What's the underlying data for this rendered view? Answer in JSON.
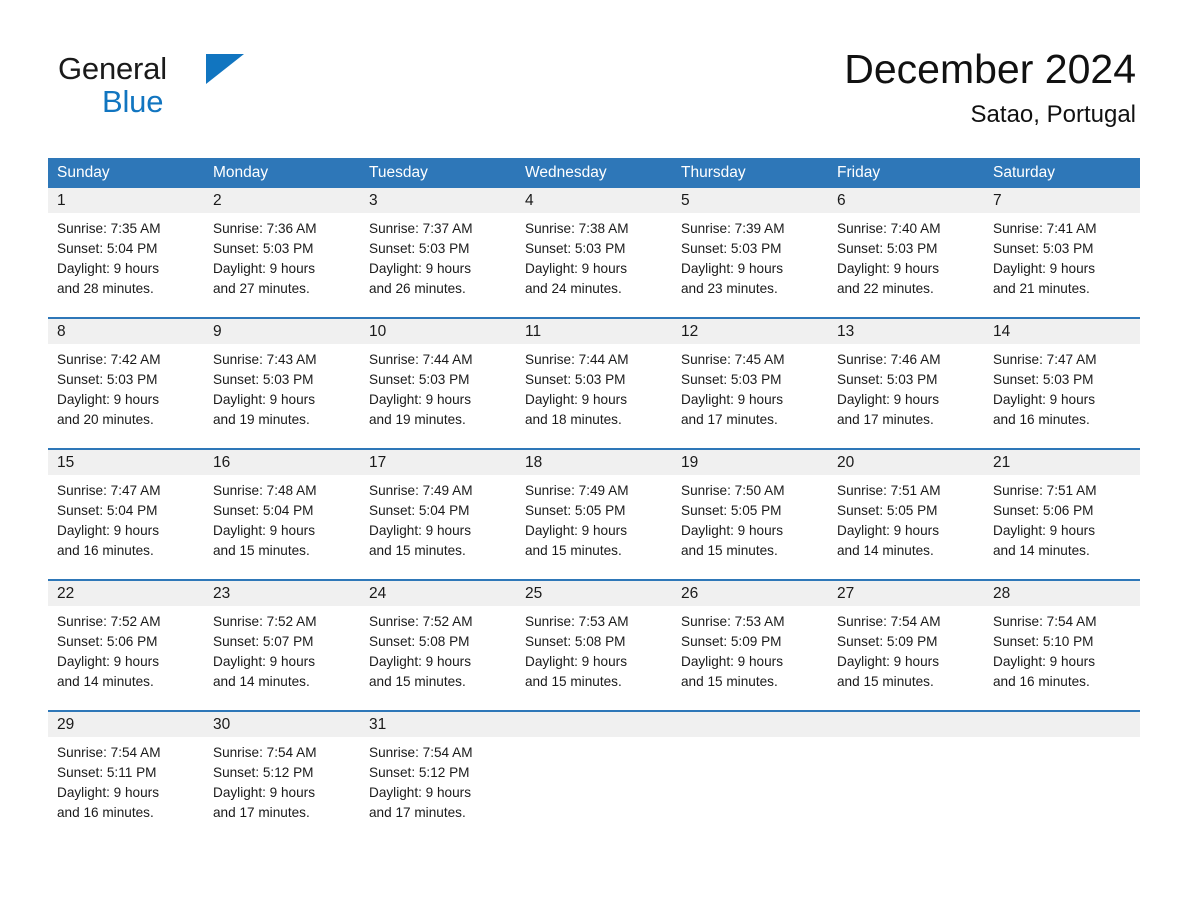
{
  "logo": {
    "word1": "General",
    "word2": "Blue",
    "triangle_color": "#1175c0"
  },
  "header": {
    "month_title": "December 2024",
    "location": "Satao, Portugal"
  },
  "colors": {
    "header_blue": "#2e77b8",
    "date_band": "#f0f0f0",
    "text": "#1a1a1a"
  },
  "weekdays": [
    "Sunday",
    "Monday",
    "Tuesday",
    "Wednesday",
    "Thursday",
    "Friday",
    "Saturday"
  ],
  "weeks": [
    {
      "days": [
        {
          "date": "1",
          "sunrise": "Sunrise: 7:35 AM",
          "sunset": "Sunset: 5:04 PM",
          "daylight1": "Daylight: 9 hours",
          "daylight2": "and 28 minutes."
        },
        {
          "date": "2",
          "sunrise": "Sunrise: 7:36 AM",
          "sunset": "Sunset: 5:03 PM",
          "daylight1": "Daylight: 9 hours",
          "daylight2": "and 27 minutes."
        },
        {
          "date": "3",
          "sunrise": "Sunrise: 7:37 AM",
          "sunset": "Sunset: 5:03 PM",
          "daylight1": "Daylight: 9 hours",
          "daylight2": "and 26 minutes."
        },
        {
          "date": "4",
          "sunrise": "Sunrise: 7:38 AM",
          "sunset": "Sunset: 5:03 PM",
          "daylight1": "Daylight: 9 hours",
          "daylight2": "and 24 minutes."
        },
        {
          "date": "5",
          "sunrise": "Sunrise: 7:39 AM",
          "sunset": "Sunset: 5:03 PM",
          "daylight1": "Daylight: 9 hours",
          "daylight2": "and 23 minutes."
        },
        {
          "date": "6",
          "sunrise": "Sunrise: 7:40 AM",
          "sunset": "Sunset: 5:03 PM",
          "daylight1": "Daylight: 9 hours",
          "daylight2": "and 22 minutes."
        },
        {
          "date": "7",
          "sunrise": "Sunrise: 7:41 AM",
          "sunset": "Sunset: 5:03 PM",
          "daylight1": "Daylight: 9 hours",
          "daylight2": "and 21 minutes."
        }
      ]
    },
    {
      "days": [
        {
          "date": "8",
          "sunrise": "Sunrise: 7:42 AM",
          "sunset": "Sunset: 5:03 PM",
          "daylight1": "Daylight: 9 hours",
          "daylight2": "and 20 minutes."
        },
        {
          "date": "9",
          "sunrise": "Sunrise: 7:43 AM",
          "sunset": "Sunset: 5:03 PM",
          "daylight1": "Daylight: 9 hours",
          "daylight2": "and 19 minutes."
        },
        {
          "date": "10",
          "sunrise": "Sunrise: 7:44 AM",
          "sunset": "Sunset: 5:03 PM",
          "daylight1": "Daylight: 9 hours",
          "daylight2": "and 19 minutes."
        },
        {
          "date": "11",
          "sunrise": "Sunrise: 7:44 AM",
          "sunset": "Sunset: 5:03 PM",
          "daylight1": "Daylight: 9 hours",
          "daylight2": "and 18 minutes."
        },
        {
          "date": "12",
          "sunrise": "Sunrise: 7:45 AM",
          "sunset": "Sunset: 5:03 PM",
          "daylight1": "Daylight: 9 hours",
          "daylight2": "and 17 minutes."
        },
        {
          "date": "13",
          "sunrise": "Sunrise: 7:46 AM",
          "sunset": "Sunset: 5:03 PM",
          "daylight1": "Daylight: 9 hours",
          "daylight2": "and 17 minutes."
        },
        {
          "date": "14",
          "sunrise": "Sunrise: 7:47 AM",
          "sunset": "Sunset: 5:03 PM",
          "daylight1": "Daylight: 9 hours",
          "daylight2": "and 16 minutes."
        }
      ]
    },
    {
      "days": [
        {
          "date": "15",
          "sunrise": "Sunrise: 7:47 AM",
          "sunset": "Sunset: 5:04 PM",
          "daylight1": "Daylight: 9 hours",
          "daylight2": "and 16 minutes."
        },
        {
          "date": "16",
          "sunrise": "Sunrise: 7:48 AM",
          "sunset": "Sunset: 5:04 PM",
          "daylight1": "Daylight: 9 hours",
          "daylight2": "and 15 minutes."
        },
        {
          "date": "17",
          "sunrise": "Sunrise: 7:49 AM",
          "sunset": "Sunset: 5:04 PM",
          "daylight1": "Daylight: 9 hours",
          "daylight2": "and 15 minutes."
        },
        {
          "date": "18",
          "sunrise": "Sunrise: 7:49 AM",
          "sunset": "Sunset: 5:05 PM",
          "daylight1": "Daylight: 9 hours",
          "daylight2": "and 15 minutes."
        },
        {
          "date": "19",
          "sunrise": "Sunrise: 7:50 AM",
          "sunset": "Sunset: 5:05 PM",
          "daylight1": "Daylight: 9 hours",
          "daylight2": "and 15 minutes."
        },
        {
          "date": "20",
          "sunrise": "Sunrise: 7:51 AM",
          "sunset": "Sunset: 5:05 PM",
          "daylight1": "Daylight: 9 hours",
          "daylight2": "and 14 minutes."
        },
        {
          "date": "21",
          "sunrise": "Sunrise: 7:51 AM",
          "sunset": "Sunset: 5:06 PM",
          "daylight1": "Daylight: 9 hours",
          "daylight2": "and 14 minutes."
        }
      ]
    },
    {
      "days": [
        {
          "date": "22",
          "sunrise": "Sunrise: 7:52 AM",
          "sunset": "Sunset: 5:06 PM",
          "daylight1": "Daylight: 9 hours",
          "daylight2": "and 14 minutes."
        },
        {
          "date": "23",
          "sunrise": "Sunrise: 7:52 AM",
          "sunset": "Sunset: 5:07 PM",
          "daylight1": "Daylight: 9 hours",
          "daylight2": "and 14 minutes."
        },
        {
          "date": "24",
          "sunrise": "Sunrise: 7:52 AM",
          "sunset": "Sunset: 5:08 PM",
          "daylight1": "Daylight: 9 hours",
          "daylight2": "and 15 minutes."
        },
        {
          "date": "25",
          "sunrise": "Sunrise: 7:53 AM",
          "sunset": "Sunset: 5:08 PM",
          "daylight1": "Daylight: 9 hours",
          "daylight2": "and 15 minutes."
        },
        {
          "date": "26",
          "sunrise": "Sunrise: 7:53 AM",
          "sunset": "Sunset: 5:09 PM",
          "daylight1": "Daylight: 9 hours",
          "daylight2": "and 15 minutes."
        },
        {
          "date": "27",
          "sunrise": "Sunrise: 7:54 AM",
          "sunset": "Sunset: 5:09 PM",
          "daylight1": "Daylight: 9 hours",
          "daylight2": "and 15 minutes."
        },
        {
          "date": "28",
          "sunrise": "Sunrise: 7:54 AM",
          "sunset": "Sunset: 5:10 PM",
          "daylight1": "Daylight: 9 hours",
          "daylight2": "and 16 minutes."
        }
      ]
    },
    {
      "days": [
        {
          "date": "29",
          "sunrise": "Sunrise: 7:54 AM",
          "sunset": "Sunset: 5:11 PM",
          "daylight1": "Daylight: 9 hours",
          "daylight2": "and 16 minutes."
        },
        {
          "date": "30",
          "sunrise": "Sunrise: 7:54 AM",
          "sunset": "Sunset: 5:12 PM",
          "daylight1": "Daylight: 9 hours",
          "daylight2": "and 17 minutes."
        },
        {
          "date": "31",
          "sunrise": "Sunrise: 7:54 AM",
          "sunset": "Sunset: 5:12 PM",
          "daylight1": "Daylight: 9 hours",
          "daylight2": "and 17 minutes."
        },
        {
          "date": "",
          "sunrise": "",
          "sunset": "",
          "daylight1": "",
          "daylight2": ""
        },
        {
          "date": "",
          "sunrise": "",
          "sunset": "",
          "daylight1": "",
          "daylight2": ""
        },
        {
          "date": "",
          "sunrise": "",
          "sunset": "",
          "daylight1": "",
          "daylight2": ""
        },
        {
          "date": "",
          "sunrise": "",
          "sunset": "",
          "daylight1": "",
          "daylight2": ""
        }
      ]
    }
  ]
}
